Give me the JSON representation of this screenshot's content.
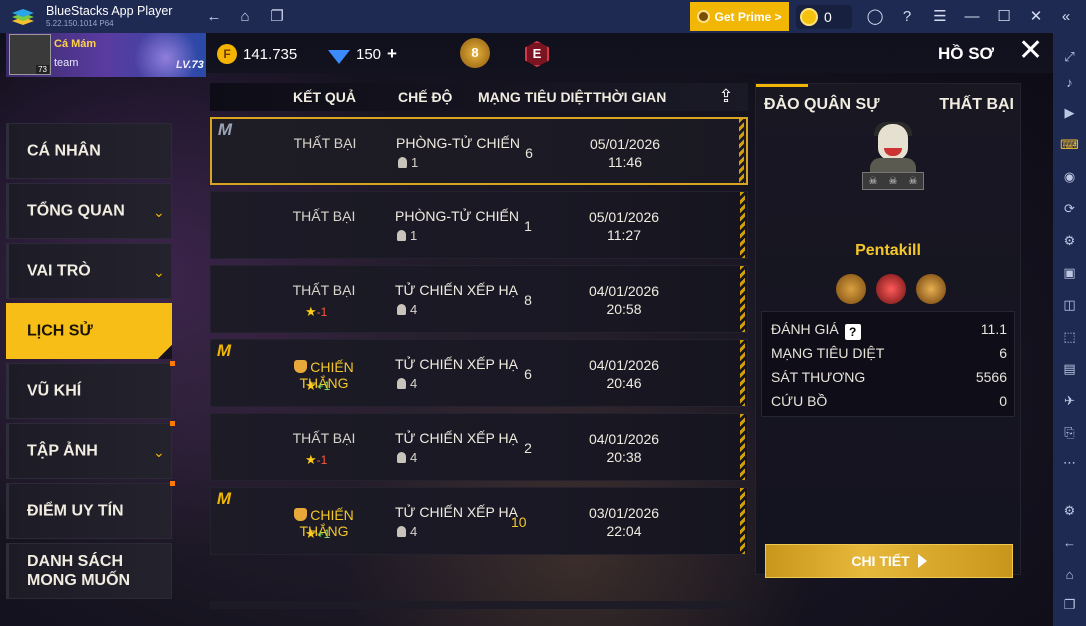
{
  "app": {
    "title": "BlueStacks App Player",
    "version": "5.22.150.1014  P64",
    "prime_label": "Get Prime >",
    "coin_count": "0"
  },
  "profile": {
    "name": "Cá Mám",
    "team": "team",
    "avatar_level": "73",
    "banner_level": "LV.73",
    "gold": "141.735",
    "diamonds": "150",
    "diamond_plus": "+",
    "rank_badge": "8",
    "e_badge": "E",
    "page_title": "HỒ SƠ"
  },
  "nav": [
    {
      "label": "CÁ NHÂN"
    },
    {
      "label": "TỔNG QUAN"
    },
    {
      "label": "VAI TRÒ"
    },
    {
      "label": "LỊCH SỬ"
    },
    {
      "label": "VŨ KHÍ"
    },
    {
      "label": "TẬP ẢNH"
    },
    {
      "label": "ĐIỂM UY TÍN"
    },
    {
      "label": "DANH SÁCH MONG MUỐN"
    }
  ],
  "table": {
    "headers": [
      "KẾT QUẢ",
      "CHẾ ĐỘ",
      "MẠNG TIÊU DIỆT",
      "THỜI GIAN"
    ],
    "rows": [
      {
        "result": "THẤT BẠI",
        "star": "",
        "mode": "PHÒNG-TỬ CHIẾN",
        "players": "1",
        "kills": "6",
        "date": "05/01/2026",
        "time": "11:46"
      },
      {
        "result": "THẤT BẠI",
        "star": "",
        "mode": "PHÒNG-TỬ CHIẾN",
        "players": "1",
        "kills": "1",
        "date": "05/01/2026",
        "time": "11:27"
      },
      {
        "result": "THẤT BẠI",
        "star": "-1",
        "mode": "TỬ CHIẾN XẾP HẠ",
        "players": "4",
        "kills": "8",
        "date": "04/01/2026",
        "time": "20:58"
      },
      {
        "result": "CHIẾN THẮNG",
        "star": "+1",
        "mode": "TỬ CHIẾN XẾP HẠ",
        "players": "4",
        "kills": "6",
        "date": "04/01/2026",
        "time": "20:46"
      },
      {
        "result": "THẤT BẠI",
        "star": "-1",
        "mode": "TỬ CHIẾN XẾP HẠ",
        "players": "4",
        "kills": "2",
        "date": "04/01/2026",
        "time": "20:38"
      },
      {
        "result": "CHIẾN THẮNG",
        "star": "+1",
        "mode": "TỬ CHIẾN XẾP HẠ",
        "players": "4",
        "kills": "10",
        "date": "03/01/2026",
        "time": "22:04"
      }
    ]
  },
  "detail": {
    "map": "ĐẢO QUÂN SỰ",
    "result": "THẤT BẠI",
    "character": "Pentakill",
    "stats": [
      {
        "label": "ĐÁNH GIÁ",
        "value": "11.1",
        "help": "?"
      },
      {
        "label": "MẠNG TIÊU DIỆT",
        "value": "6"
      },
      {
        "label": "SÁT THƯƠNG",
        "value": "5566"
      },
      {
        "label": "CỨU BỒ",
        "value": "0"
      }
    ],
    "button": "CHI TIẾT"
  }
}
